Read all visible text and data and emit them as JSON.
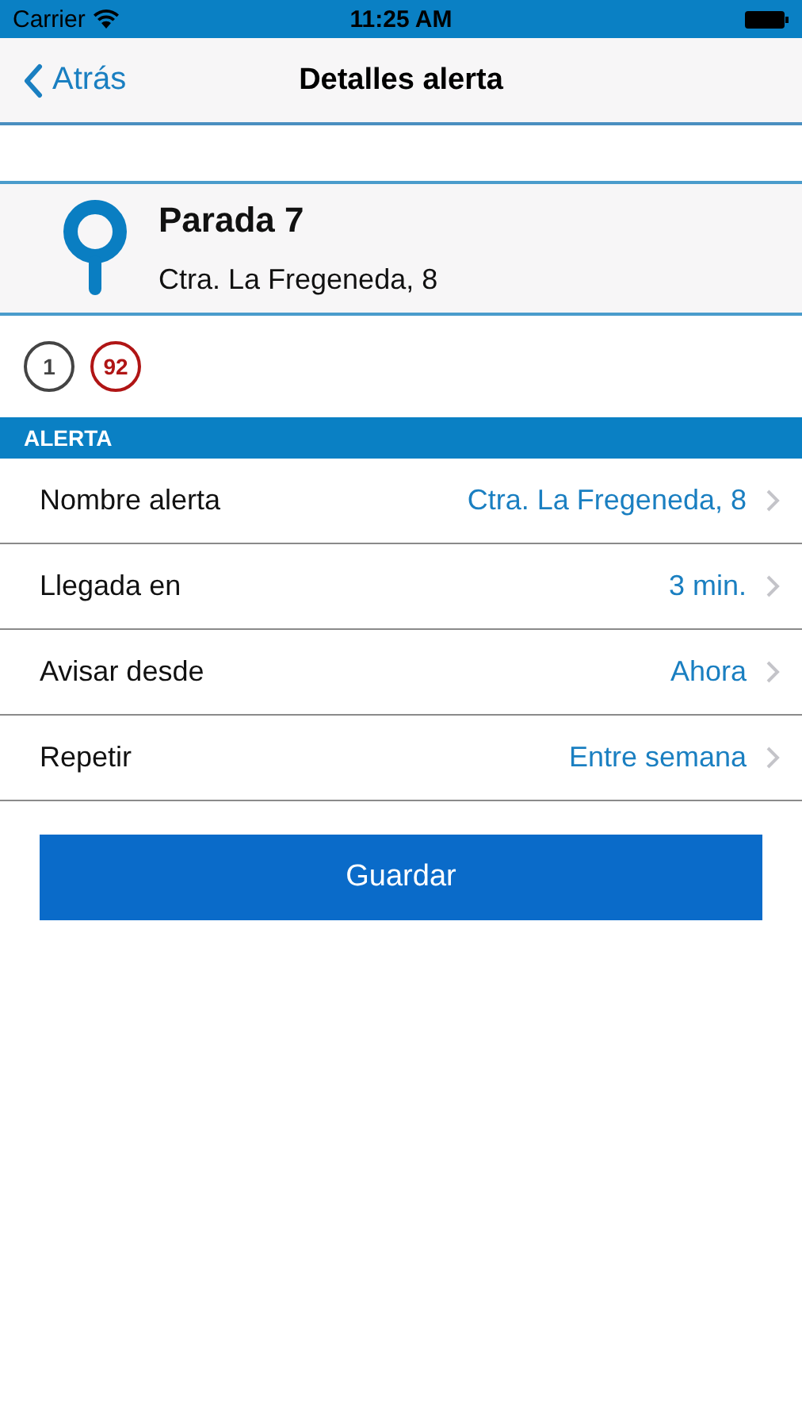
{
  "status_bar": {
    "carrier": "Carrier",
    "time": "11:25 AM"
  },
  "nav": {
    "back": "Atrás",
    "title": "Detalles alerta"
  },
  "stop": {
    "name": "Parada 7",
    "address": "Ctra. La Fregeneda, 8"
  },
  "lines": [
    {
      "label": "1",
      "color": "#444444"
    },
    {
      "label": "92",
      "color": "#b01515"
    }
  ],
  "section": {
    "title": "ALERTA"
  },
  "rows": [
    {
      "label": "Nombre alerta",
      "value": "Ctra. La Fregeneda, 8"
    },
    {
      "label": "Llegada en",
      "value": "3 min."
    },
    {
      "label": "Avisar desde",
      "value": "Ahora"
    },
    {
      "label": "Repetir",
      "value": "Entre semana"
    }
  ],
  "save_button": "Guardar"
}
